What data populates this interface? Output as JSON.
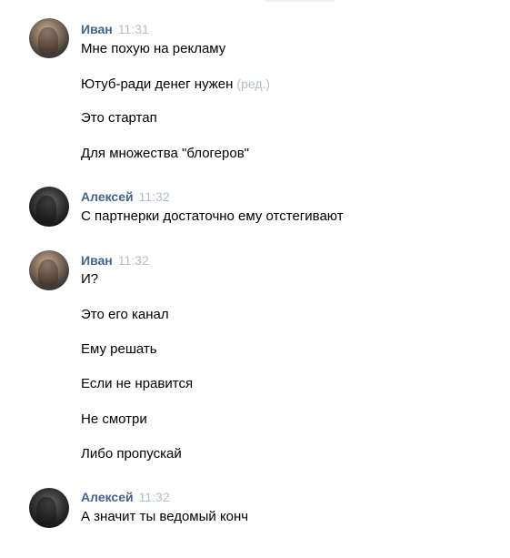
{
  "messages": [
    {
      "author": "Иван",
      "time": "11:31",
      "avatar": "ivan-avatar",
      "lines": [
        {
          "text": "Мне похую на рекламу"
        },
        {
          "text": "Ютуб-ради денег нужен",
          "edited": "(ред.)"
        },
        {
          "text": "Это стартап"
        },
        {
          "text": "Для множества \"блогеров\""
        }
      ]
    },
    {
      "author": "Алексей",
      "time": "11:32",
      "avatar": "aleksey-avatar",
      "lines": [
        {
          "text": "С партнерки достаточно ему отстегивают"
        }
      ]
    },
    {
      "author": "Иван",
      "time": "11:32",
      "avatar": "ivan-avatar",
      "lines": [
        {
          "text": "И?"
        },
        {
          "text": "Это его канал"
        },
        {
          "text": "Ему решать"
        },
        {
          "text": "Если не нравится"
        },
        {
          "text": "Не смотри"
        },
        {
          "text": "Либо пропускай"
        }
      ]
    },
    {
      "author": "Алексей",
      "time": "11:32",
      "avatar": "aleksey-avatar",
      "lines": [
        {
          "text": "А значит ты ведомый конч"
        }
      ]
    }
  ],
  "colors": {
    "author": "#42648b",
    "meta": "#b3bcc8",
    "text": "#000000",
    "background": "#ffffff"
  }
}
